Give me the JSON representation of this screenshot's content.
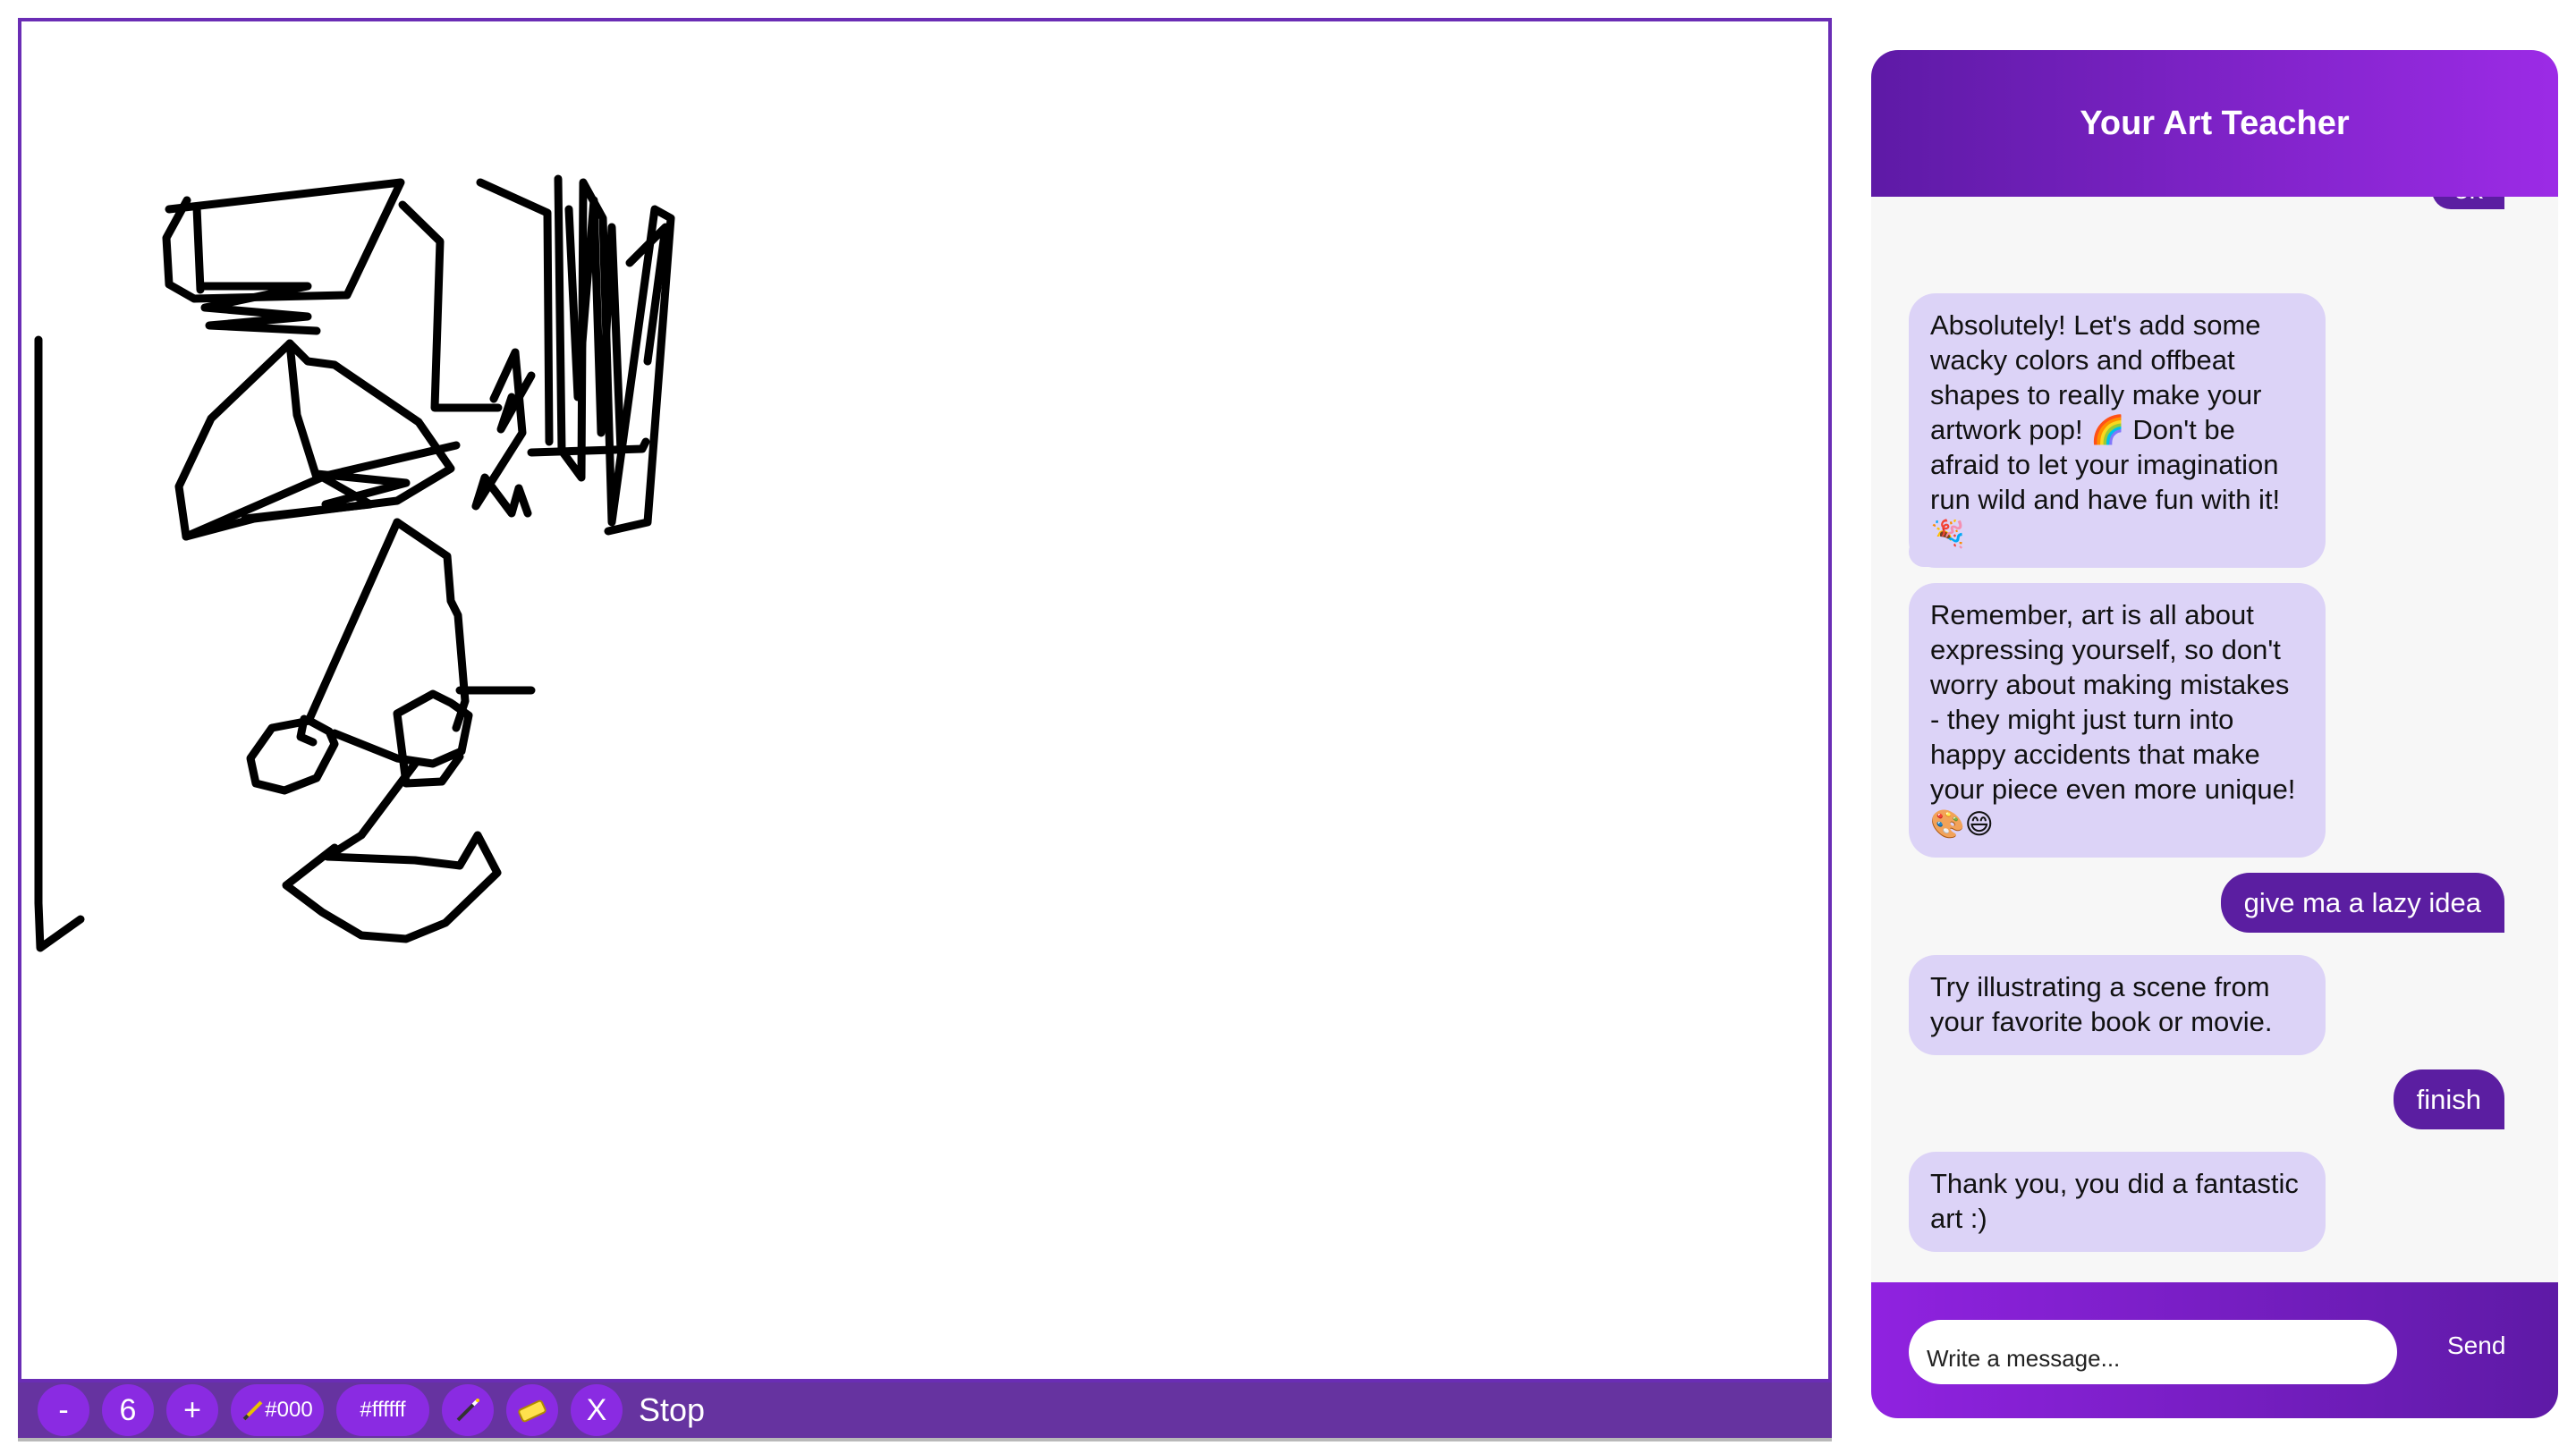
{
  "canvas": {
    "stroke_color": "#000000",
    "background": "#ffffff"
  },
  "toolbar": {
    "decrease_label": "-",
    "brush_size": "6",
    "increase_label": "+",
    "stroke_color_value": "#000",
    "fill_color_value": "#ffffff",
    "magic_wand_icon": "magic-wand-icon",
    "eraser_icon": "eraser-icon",
    "clear_label": "X",
    "stop_label": "Stop"
  },
  "chat": {
    "title": "Your Art Teacher",
    "partial_top_message": "ok",
    "messages": [
      {
        "role": "bot",
        "text": "Absolutely! Let's add some wacky colors and offbeat shapes to really make your artwork pop! 🌈 Don't be afraid to let your imagination run wild and have fun with it! 🎉"
      },
      {
        "role": "bot",
        "text": ""
      },
      {
        "role": "bot",
        "text": "Remember, art is all about expressing yourself, so don't worry about making mistakes - they might just turn into happy accidents that make your piece even more unique! 🎨😄"
      },
      {
        "role": "user",
        "text": "give ma a lazy idea"
      },
      {
        "role": "bot",
        "text": "Try illustrating a scene from your favorite book or movie."
      },
      {
        "role": "user",
        "text": "finish"
      },
      {
        "role": "bot",
        "text": "Thank you, you did a fantastic art :)"
      }
    ],
    "input_placeholder": "Write a message...",
    "send_label": "Send"
  },
  "colors": {
    "accent": "#8a2be2",
    "toolbar_bg": "#6633a0",
    "user_bubble": "#5b1ea1",
    "bot_bubble": "#dcd3f7"
  }
}
